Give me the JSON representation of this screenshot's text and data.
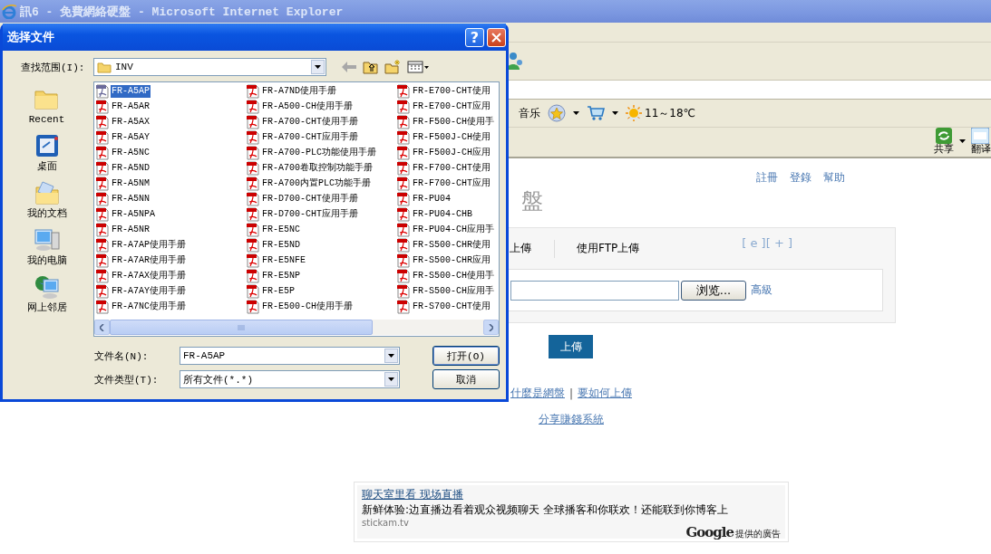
{
  "browser": {
    "title": "訊6 - 免費網絡硬盤 - Microsoft Internet Explorer",
    "links_bar": {
      "music": "音乐",
      "weather": "11～18℃"
    },
    "tools": [
      {
        "kind": "share",
        "label": "共享"
      },
      {
        "kind": "translate",
        "label": "翻译"
      }
    ]
  },
  "page": {
    "top_links": [
      "註冊",
      "登錄",
      "幫助"
    ],
    "heading": "盤",
    "upload_tabs": [
      "上傳",
      "使用FTP上傳"
    ],
    "expand_links": "[ e ][ + ]",
    "browse_button": "浏览...",
    "advanced_link": "高級",
    "upload_button": "上傳",
    "help_links": [
      "什麼是網盤",
      "要如何上傳"
    ],
    "help_separator": "|",
    "share_link": "分享賺錢系統",
    "ad": {
      "title": "聊天室里看 现场直播",
      "text": "新鲜体验:边直播边看着观众视频聊天 全球播客和你联欢！还能联到你博客上",
      "domain": "stickam.tv",
      "brand": "Google",
      "brand_note": "提供的廣告"
    }
  },
  "dialog": {
    "title": "选择文件",
    "help_button": "?",
    "look_in": {
      "label": "查找范围(I):",
      "value": "INV"
    },
    "places": [
      {
        "kind": "recent",
        "label": "Recent"
      },
      {
        "kind": "desktop",
        "label": "桌面"
      },
      {
        "kind": "documents",
        "label": "我的文档"
      },
      {
        "kind": "computer",
        "label": "我的电脑"
      },
      {
        "kind": "network",
        "label": "网上邻居"
      }
    ],
    "files": [
      {
        "name": "FR-A5AP",
        "selected": true
      },
      {
        "name": "FR-A5AR",
        "selected": false
      },
      {
        "name": "FR-A5AX",
        "selected": false
      },
      {
        "name": "FR-A5AY",
        "selected": false
      },
      {
        "name": "FR-A5NC",
        "selected": false
      },
      {
        "name": "FR-A5ND",
        "selected": false
      },
      {
        "name": "FR-A5NM",
        "selected": false
      },
      {
        "name": "FR-A5NN",
        "selected": false
      },
      {
        "name": "FR-A5NPA",
        "selected": false
      },
      {
        "name": "FR-A5NR",
        "selected": false
      },
      {
        "name": "FR-A7AP使用手册",
        "selected": false
      },
      {
        "name": "FR-A7AR使用手册",
        "selected": false
      },
      {
        "name": "FR-A7AX使用手册",
        "selected": false
      },
      {
        "name": "FR-A7AY使用手册",
        "selected": false
      },
      {
        "name": "FR-A7NC使用手册",
        "selected": false
      },
      {
        "name": "FR-A7ND使用手册",
        "selected": false
      },
      {
        "name": "FR-A500-CH使用手册",
        "selected": false
      },
      {
        "name": "FR-A700-CHT使用手册",
        "selected": false
      },
      {
        "name": "FR-A700-CHT应用手册",
        "selected": false
      },
      {
        "name": "FR-A700-PLC功能使用手册",
        "selected": false
      },
      {
        "name": "FR-A700卷取控制功能手册",
        "selected": false
      },
      {
        "name": "FR-A700内置PLC功能手册",
        "selected": false
      },
      {
        "name": "FR-D700-CHT使用手册",
        "selected": false
      },
      {
        "name": "FR-D700-CHT应用手册",
        "selected": false
      },
      {
        "name": "FR-E5NC",
        "selected": false
      },
      {
        "name": "FR-E5ND",
        "selected": false
      },
      {
        "name": "FR-E5NFE",
        "selected": false
      },
      {
        "name": "FR-E5NP",
        "selected": false
      },
      {
        "name": "FR-E5P",
        "selected": false
      },
      {
        "name": "FR-E500-CH使用手册",
        "selected": false
      },
      {
        "name": "FR-E700-CHT使用",
        "selected": false
      },
      {
        "name": "FR-E700-CHT应用",
        "selected": false
      },
      {
        "name": "FR-F500-CH使用手",
        "selected": false
      },
      {
        "name": "FR-F500J-CH使用",
        "selected": false
      },
      {
        "name": "FR-F500J-CH应用",
        "selected": false
      },
      {
        "name": "FR-F700-CHT使用",
        "selected": false
      },
      {
        "name": "FR-F700-CHT应用",
        "selected": false
      },
      {
        "name": "FR-PU04",
        "selected": false
      },
      {
        "name": "FR-PU04-CHB",
        "selected": false
      },
      {
        "name": "FR-PU04-CH应用手",
        "selected": false
      },
      {
        "name": "FR-S500-CHR使用",
        "selected": false
      },
      {
        "name": "FR-S500-CHR应用",
        "selected": false
      },
      {
        "name": "FR-S500-CH使用手",
        "selected": false
      },
      {
        "name": "FR-S500-CH应用手",
        "selected": false
      },
      {
        "name": "FR-S700-CHT使用",
        "selected": false
      }
    ],
    "file_name": {
      "label": "文件名(N):",
      "value": "FR-A5AP"
    },
    "file_type": {
      "label": "文件类型(T):",
      "value": "所有文件(*.*)"
    },
    "buttons": [
      "打开(O)",
      "取消"
    ]
  }
}
